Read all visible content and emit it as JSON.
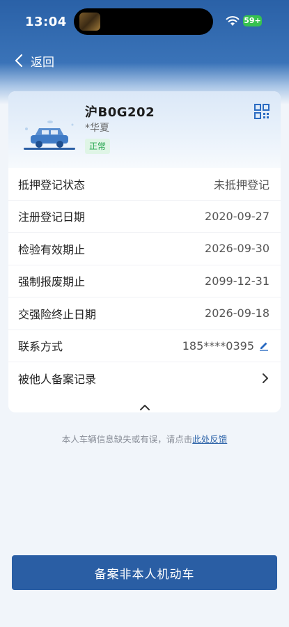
{
  "status_bar": {
    "time": "13:04",
    "battery": "59+"
  },
  "nav": {
    "back_label": "返回"
  },
  "vehicle": {
    "plate": "沪B0G202",
    "model": "*华夏",
    "status": "正常"
  },
  "rows": [
    {
      "label": "抵押登记状态",
      "value": "未抵押登记"
    },
    {
      "label": "注册登记日期",
      "value": "2020-09-27"
    },
    {
      "label": "检验有效期止",
      "value": "2026-09-30"
    },
    {
      "label": "强制报废期止",
      "value": "2099-12-31"
    },
    {
      "label": "交强险终止日期",
      "value": "2026-09-18"
    },
    {
      "label": "联系方式",
      "value": "185****0395"
    },
    {
      "label": "被他人备案记录",
      "value": ""
    }
  ],
  "feedback": {
    "text": "本人车辆信息缺失或有误，请点击",
    "link": "此处反馈"
  },
  "primary_button": "备案非本人机动车",
  "colors": {
    "brand": "#2a5ea4",
    "status_green": "#21a44a",
    "background": "#f1f5fa"
  }
}
